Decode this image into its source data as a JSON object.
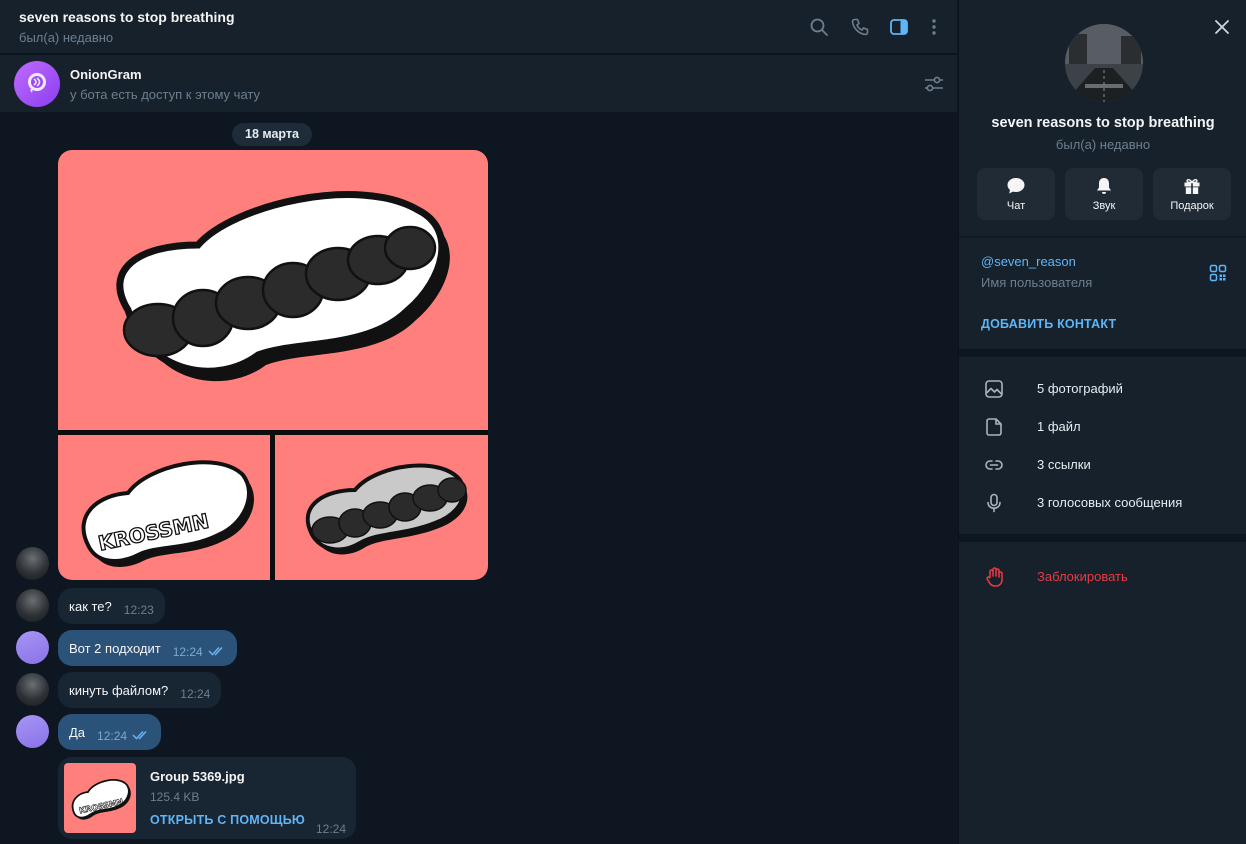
{
  "chat": {
    "title": "seven reasons to stop breathing",
    "status": "был(а) недавно",
    "header_icons": [
      "search-icon",
      "phone-icon",
      "sidebar-toggle-icon",
      "more-vertical-icon"
    ]
  },
  "pinned_bot": {
    "name": "OnionGram",
    "subtitle": "у бота есть доступ к этому чату"
  },
  "date_separator": "18 марта",
  "album": {
    "images": [
      "KROSSMN sticker large",
      "KROSSMN sticker outline",
      "KROSSMN sticker grey"
    ]
  },
  "messages": [
    {
      "direction": "in",
      "text": "как те?",
      "time": "12:23"
    },
    {
      "direction": "out",
      "text": "Вот 2 подходит",
      "time": "12:24",
      "read": true
    },
    {
      "direction": "in",
      "text": "кинуть файлом?",
      "time": "12:24"
    },
    {
      "direction": "out",
      "text": "Да",
      "time": "12:24",
      "read": true
    }
  ],
  "file_message": {
    "name": "Group 5369.jpg",
    "size": "125.4 KB",
    "open_label": "ОТКРЫТЬ С ПОМОЩЬЮ",
    "time": "12:24"
  },
  "panel": {
    "name": "seven reasons to stop breathing",
    "status": "был(а) недавно",
    "actions": [
      {
        "icon": "chat-bubble-icon",
        "label": "Чат"
      },
      {
        "icon": "bell-icon",
        "label": "Звук"
      },
      {
        "icon": "gift-icon",
        "label": "Подарок"
      }
    ],
    "username": "@seven_reason",
    "username_caption": "Имя пользователя",
    "add_contact": "ДОБАВИТЬ КОНТАКТ",
    "media": [
      {
        "icon": "photo-icon",
        "label": "5 фотографий"
      },
      {
        "icon": "file-icon",
        "label": "1 файл"
      },
      {
        "icon": "link-icon",
        "label": "3 ссылки"
      },
      {
        "icon": "microphone-icon",
        "label": "3 голосовых сообщения"
      }
    ],
    "block": {
      "icon": "hand-stop-icon",
      "label": "Заблокировать"
    }
  },
  "colors": {
    "accent": "#5eb5f7",
    "danger": "#ec3942",
    "outgoing_bubble": "#2b5278",
    "incoming_bubble": "#182533",
    "sticker_background": "#ff7f7d"
  }
}
